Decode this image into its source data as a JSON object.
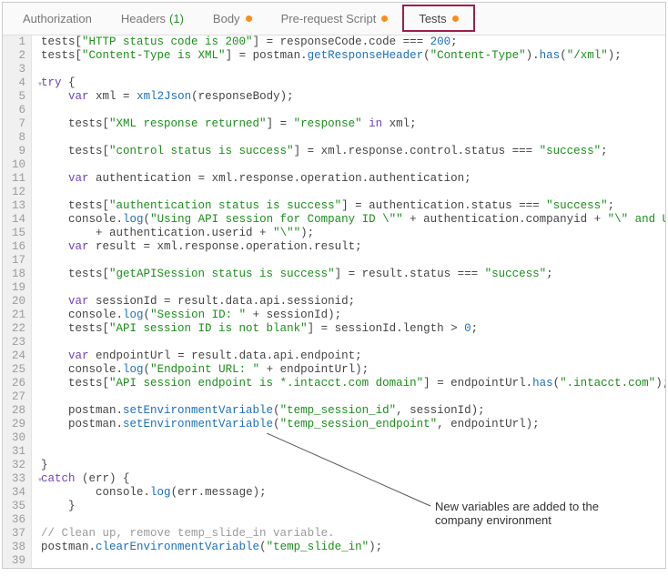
{
  "tabs": [
    {
      "label": "Authorization",
      "count": "",
      "dot": false,
      "active": false
    },
    {
      "label": "Headers",
      "count": "(1)",
      "dot": false,
      "active": false
    },
    {
      "label": "Body",
      "count": "",
      "dot": true,
      "active": false
    },
    {
      "label": "Pre-request Script",
      "count": "",
      "dot": true,
      "active": false
    },
    {
      "label": "Tests",
      "count": "",
      "dot": true,
      "active": true
    }
  ],
  "code": {
    "lines": [
      {
        "n": 1,
        "seg": [
          [
            "pl",
            "tests["
          ],
          [
            "str",
            "\"HTTP status code is 200\""
          ],
          [
            "pl",
            "] = responseCode.code === "
          ],
          [
            "num",
            "200"
          ],
          [
            "pl",
            ";"
          ]
        ]
      },
      {
        "n": 2,
        "seg": [
          [
            "pl",
            "tests["
          ],
          [
            "str",
            "\"Content-Type is XML\""
          ],
          [
            "pl",
            "] = postman."
          ],
          [
            "fn",
            "getResponseHeader"
          ],
          [
            "pl",
            "("
          ],
          [
            "str",
            "\"Content-Type\""
          ],
          [
            "pl",
            ")."
          ],
          [
            "fn",
            "has"
          ],
          [
            "pl",
            "("
          ],
          [
            "str",
            "\"/xml\""
          ],
          [
            "pl",
            ");"
          ]
        ]
      },
      {
        "n": 3,
        "seg": [
          [
            "pl",
            ""
          ]
        ]
      },
      {
        "n": 4,
        "fold": true,
        "seg": [
          [
            "kw",
            "try"
          ],
          [
            "pl",
            " {"
          ]
        ]
      },
      {
        "n": 5,
        "seg": [
          [
            "pl",
            "    "
          ],
          [
            "kw",
            "var"
          ],
          [
            "pl",
            " xml = "
          ],
          [
            "fn",
            "xml2Json"
          ],
          [
            "pl",
            "(responseBody);"
          ]
        ]
      },
      {
        "n": 6,
        "seg": [
          [
            "pl",
            ""
          ]
        ]
      },
      {
        "n": 7,
        "seg": [
          [
            "pl",
            "    tests["
          ],
          [
            "str",
            "\"XML response returned\""
          ],
          [
            "pl",
            "] = "
          ],
          [
            "str",
            "\"response\""
          ],
          [
            "pl",
            " "
          ],
          [
            "kw",
            "in"
          ],
          [
            "pl",
            " xml;"
          ]
        ]
      },
      {
        "n": 8,
        "seg": [
          [
            "pl",
            ""
          ]
        ]
      },
      {
        "n": 9,
        "seg": [
          [
            "pl",
            "    tests["
          ],
          [
            "str",
            "\"control status is success\""
          ],
          [
            "pl",
            "] = xml.response.control.status === "
          ],
          [
            "str",
            "\"success\""
          ],
          [
            "pl",
            ";"
          ]
        ]
      },
      {
        "n": 10,
        "seg": [
          [
            "pl",
            ""
          ]
        ]
      },
      {
        "n": 11,
        "seg": [
          [
            "pl",
            "    "
          ],
          [
            "kw",
            "var"
          ],
          [
            "pl",
            " authentication = xml.response.operation.authentication;"
          ]
        ]
      },
      {
        "n": 12,
        "seg": [
          [
            "pl",
            ""
          ]
        ]
      },
      {
        "n": 13,
        "seg": [
          [
            "pl",
            "    tests["
          ],
          [
            "str",
            "\"authentication status is success\""
          ],
          [
            "pl",
            "] = authentication.status === "
          ],
          [
            "str",
            "\"success\""
          ],
          [
            "pl",
            ";"
          ]
        ]
      },
      {
        "n": 14,
        "seg": [
          [
            "pl",
            "    console."
          ],
          [
            "fn",
            "log"
          ],
          [
            "pl",
            "("
          ],
          [
            "str",
            "\"Using API session for Company ID \\\"\""
          ],
          [
            "pl",
            " + authentication.companyid + "
          ],
          [
            "str",
            "\"\\\" and User ID \\\"\""
          ]
        ]
      },
      {
        "n": 15,
        "seg": [
          [
            "pl",
            "        + authentication.userid + "
          ],
          [
            "str",
            "\"\\\"\""
          ],
          [
            "pl",
            ");"
          ]
        ]
      },
      {
        "n": 16,
        "seg": [
          [
            "pl",
            "    "
          ],
          [
            "kw",
            "var"
          ],
          [
            "pl",
            " result = xml.response.operation.result;"
          ]
        ]
      },
      {
        "n": 17,
        "seg": [
          [
            "pl",
            ""
          ]
        ]
      },
      {
        "n": 18,
        "seg": [
          [
            "pl",
            "    tests["
          ],
          [
            "str",
            "\"getAPISession status is success\""
          ],
          [
            "pl",
            "] = result.status === "
          ],
          [
            "str",
            "\"success\""
          ],
          [
            "pl",
            ";"
          ]
        ]
      },
      {
        "n": 19,
        "seg": [
          [
            "pl",
            ""
          ]
        ]
      },
      {
        "n": 20,
        "seg": [
          [
            "pl",
            "    "
          ],
          [
            "kw",
            "var"
          ],
          [
            "pl",
            " sessionId = result.data.api.sessionid;"
          ]
        ]
      },
      {
        "n": 21,
        "seg": [
          [
            "pl",
            "    console."
          ],
          [
            "fn",
            "log"
          ],
          [
            "pl",
            "("
          ],
          [
            "str",
            "\"Session ID: \""
          ],
          [
            "pl",
            " + sessionId);"
          ]
        ]
      },
      {
        "n": 22,
        "seg": [
          [
            "pl",
            "    tests["
          ],
          [
            "str",
            "\"API session ID is not blank\""
          ],
          [
            "pl",
            "] = sessionId.length > "
          ],
          [
            "num",
            "0"
          ],
          [
            "pl",
            ";"
          ]
        ]
      },
      {
        "n": 23,
        "seg": [
          [
            "pl",
            ""
          ]
        ]
      },
      {
        "n": 24,
        "seg": [
          [
            "pl",
            "    "
          ],
          [
            "kw",
            "var"
          ],
          [
            "pl",
            " endpointUrl = result.data.api.endpoint;"
          ]
        ]
      },
      {
        "n": 25,
        "seg": [
          [
            "pl",
            "    console."
          ],
          [
            "fn",
            "log"
          ],
          [
            "pl",
            "("
          ],
          [
            "str",
            "\"Endpoint URL: \""
          ],
          [
            "pl",
            " + endpointUrl);"
          ]
        ]
      },
      {
        "n": 26,
        "seg": [
          [
            "pl",
            "    tests["
          ],
          [
            "str",
            "\"API session endpoint is *.intacct.com domain\""
          ],
          [
            "pl",
            "] = endpointUrl."
          ],
          [
            "fn",
            "has"
          ],
          [
            "pl",
            "("
          ],
          [
            "str",
            "\".intacct.com\""
          ],
          [
            "pl",
            ");"
          ]
        ]
      },
      {
        "n": 27,
        "seg": [
          [
            "pl",
            ""
          ]
        ]
      },
      {
        "n": 28,
        "seg": [
          [
            "pl",
            "    postman."
          ],
          [
            "fn",
            "setEnvironmentVariable"
          ],
          [
            "pl",
            "("
          ],
          [
            "str",
            "\"temp_session_id\""
          ],
          [
            "pl",
            ", sessionId);"
          ]
        ]
      },
      {
        "n": 29,
        "seg": [
          [
            "pl",
            "    postman."
          ],
          [
            "fn",
            "setEnvironmentVariable"
          ],
          [
            "pl",
            "("
          ],
          [
            "str",
            "\"temp_session_endpoint\""
          ],
          [
            "pl",
            ", endpointUrl);"
          ]
        ]
      },
      {
        "n": 30,
        "seg": [
          [
            "pl",
            ""
          ]
        ]
      },
      {
        "n": 31,
        "seg": [
          [
            "pl",
            ""
          ]
        ]
      },
      {
        "n": 32,
        "seg": [
          [
            "pl",
            "}"
          ]
        ]
      },
      {
        "n": 33,
        "fold": true,
        "seg": [
          [
            "kw",
            "catch"
          ],
          [
            "pl",
            " (err) {"
          ]
        ]
      },
      {
        "n": 34,
        "seg": [
          [
            "pl",
            "        console."
          ],
          [
            "fn",
            "log"
          ],
          [
            "pl",
            "(err.message);"
          ]
        ]
      },
      {
        "n": 35,
        "seg": [
          [
            "pl",
            "    }"
          ]
        ]
      },
      {
        "n": 36,
        "seg": [
          [
            "pl",
            ""
          ]
        ]
      },
      {
        "n": 37,
        "seg": [
          [
            "cm",
            "// Clean up, remove temp_slide_in variable."
          ]
        ]
      },
      {
        "n": 38,
        "seg": [
          [
            "pl",
            "postman."
          ],
          [
            "fn",
            "clearEnvironmentVariable"
          ],
          [
            "pl",
            "("
          ],
          [
            "str",
            "\"temp_slide_in\""
          ],
          [
            "pl",
            ");"
          ]
        ]
      },
      {
        "n": 39,
        "seg": [
          [
            "pl",
            ""
          ]
        ]
      }
    ]
  },
  "annotation": {
    "text": "New variables are added to the company environment"
  }
}
